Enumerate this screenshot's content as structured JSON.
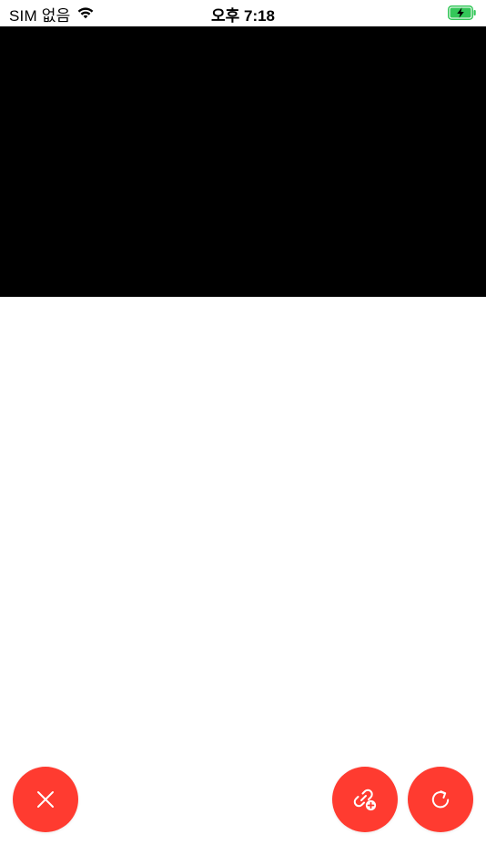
{
  "status_bar": {
    "carrier": "SIM 없음",
    "time": "오후 7:18",
    "wifi_icon": "wifi-icon",
    "battery_icon": "battery-charging-icon",
    "battery_color": "#34c759"
  },
  "video": {
    "background": "#000000"
  },
  "actions": {
    "accent_color": "#ff3b30",
    "close_icon": "close-icon",
    "add_link_icon": "add-link-icon",
    "refresh_icon": "refresh-icon"
  }
}
